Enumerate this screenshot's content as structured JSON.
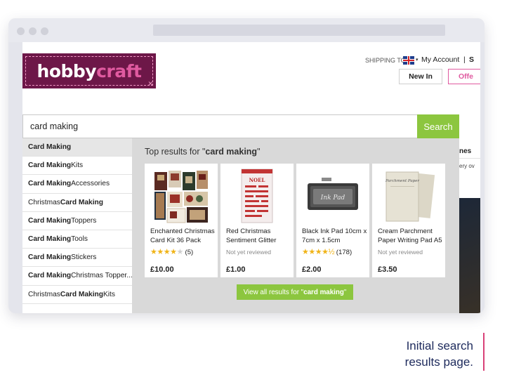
{
  "brand": {
    "logo_part1": "hobby",
    "logo_part2": "craft"
  },
  "header": {
    "shipping_label": "SHIPPING TO",
    "my_account": "My Account",
    "separator": "|",
    "truncated_link": "S",
    "new_in": "New In",
    "offers": "Offe"
  },
  "search": {
    "value": "card making",
    "button": "Search"
  },
  "background_text": {
    "heading_fragment": "nes",
    "sub_fragment": "ery ov"
  },
  "suggestions": [
    {
      "bold": "Card Making",
      "rest": ""
    },
    {
      "bold": "Card Making",
      "rest": " Kits"
    },
    {
      "bold": "Card Making",
      "rest": " Accessories"
    },
    {
      "pre": "Christmas ",
      "bold": "Card Making",
      "rest": ""
    },
    {
      "bold": "Card Making",
      "rest": " Toppers"
    },
    {
      "bold": "Card Making",
      "rest": " Tools"
    },
    {
      "bold": "Card Making",
      "rest": " Stickers"
    },
    {
      "bold": "Card Making",
      "rest": " Christmas Topper..."
    },
    {
      "pre": "Christmas ",
      "bold": "Card Making",
      "rest": " Kits"
    }
  ],
  "top_results": {
    "prefix": "Top results for \"",
    "query": "card making",
    "suffix": "\"",
    "products": [
      {
        "name": "Enchanted Christmas Card Kit 36 Pack",
        "rating": 4,
        "reviews": "(5)",
        "price": "£10.00",
        "image": "card-kit-image"
      },
      {
        "name": "Red Christmas Sentiment Glitter",
        "review_text": "Not yet reviewed",
        "price": "£1.00",
        "image": "glitter-sticker-image"
      },
      {
        "name": "Black Ink Pad 10cm x 7cm x 1.5cm",
        "rating": 4.5,
        "reviews": "(178)",
        "price": "£2.00",
        "image": "ink-pad-image",
        "pad_label": "Ink Pad"
      },
      {
        "name": "Cream Parchment Paper Writing Pad A5",
        "review_text": "Not yet reviewed",
        "price": "£3.50",
        "image": "parchment-pad-image",
        "pad_label": "Parchment Paper"
      }
    ],
    "view_all_prefix": "View all results for \"",
    "view_all_query": "card making",
    "view_all_suffix": "\""
  },
  "caption": {
    "line1": "Initial search",
    "line2": "results page."
  },
  "colors": {
    "brand": "#6d1748",
    "accent_pink": "#e05aa0",
    "search_green": "#8cc63f",
    "star": "#f0b418",
    "caption": "#1d2a5c"
  }
}
